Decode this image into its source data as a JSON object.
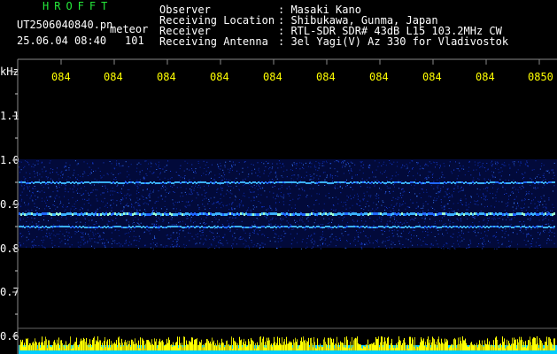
{
  "header": {
    "brand": "HROFFT",
    "filename": "UT2506040840.pn",
    "detector": "meteor",
    "datetime": "25.06.04 08:40",
    "count": "101"
  },
  "station": {
    "labels": [
      "Observer",
      "Receiving Location",
      "Receiver",
      "Receiving Antenna"
    ],
    "values": [
      ": Masaki Kano",
      ": Shibukawa, Gunma, Japan",
      ": RTL-SDR SDR# 43dB L15 103.2MHz CW",
      ": 3el Yagi(V) Az 330 for Vladivostok"
    ]
  },
  "axes": {
    "y_unit": "kHz",
    "y_ticks": [
      "1.1",
      "1.0",
      "0.9",
      "0.8",
      "0.7",
      "0.6"
    ],
    "x_ticks": [
      "084",
      "084",
      "084",
      "084",
      "084",
      "084",
      "084",
      "084",
      "084",
      "0850"
    ]
  },
  "spectrogram": {
    "freq_range_khz": [
      0.6,
      1.1
    ],
    "noise_band_khz": [
      0.8,
      1.0
    ],
    "signal_lines_khz": [
      0.95,
      0.88,
      0.85
    ],
    "colors": {
      "text_label": "#ffffff",
      "brand": "#25e83a",
      "time_ticks": "#ffff00",
      "noise": "#0a2aa8",
      "signal": "#3ab0ff",
      "histogram_fill": "#00ccff",
      "histogram_spikes": "#ffff00"
    }
  }
}
